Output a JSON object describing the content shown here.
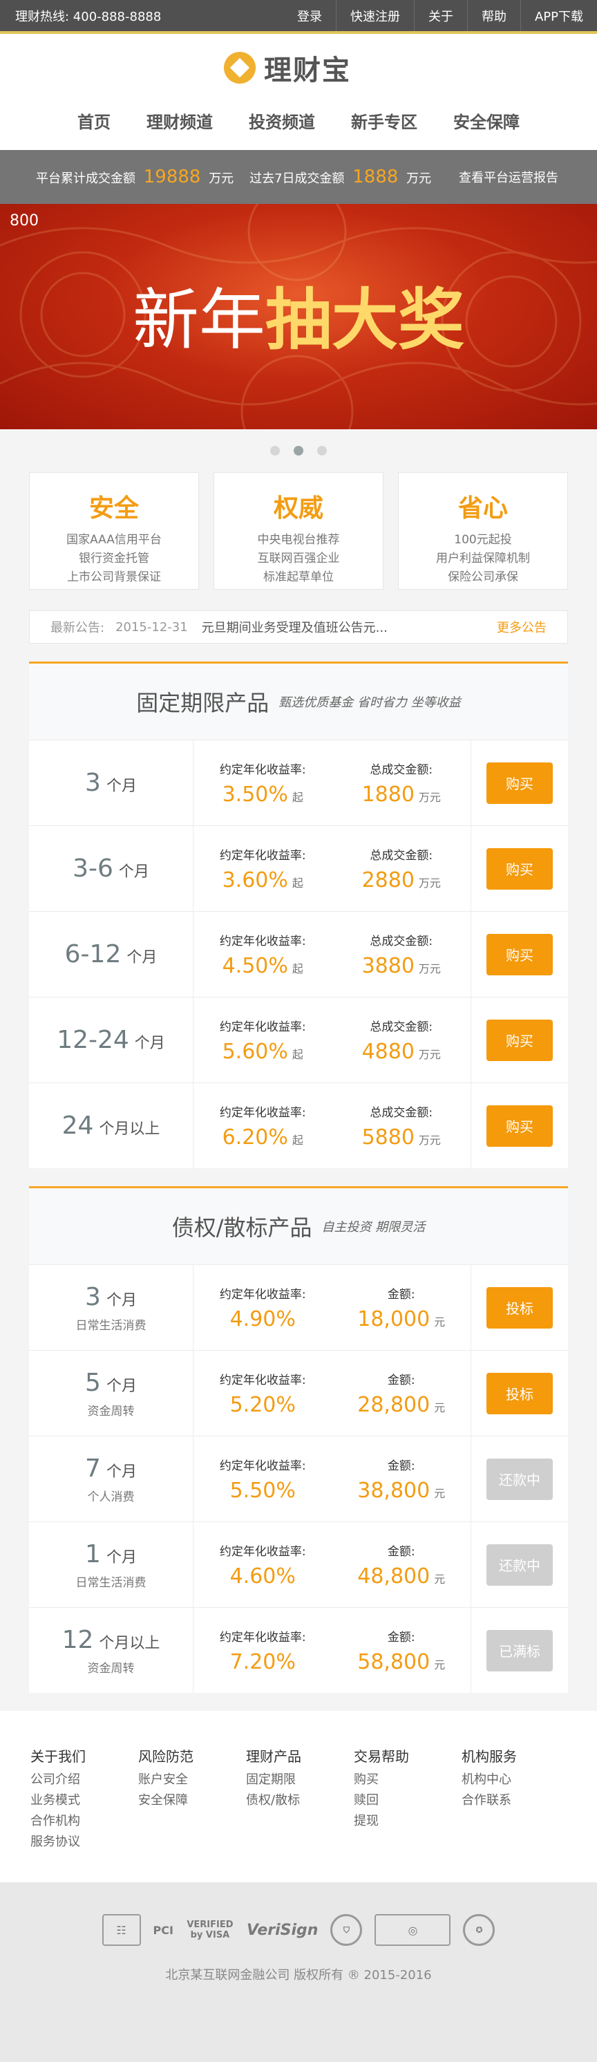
{
  "topbar": {
    "hotline": "理财热线: 400-888-8888",
    "links": [
      "登录",
      "快速注册",
      "关于",
      "帮助",
      "APP下载"
    ]
  },
  "header": {
    "logo_text": "理财宝",
    "nav": [
      "首页",
      "理财频道",
      "投资频道",
      "新手专区",
      "安全保障"
    ]
  },
  "stats": {
    "label1": "平台累计成交金额",
    "amount1": "19888",
    "unit1": "万元",
    "label2": "过去7日成交金额",
    "amount2": "1888",
    "unit2": "万元",
    "report": "查看平台运营报告"
  },
  "banner": {
    "size_label": "800",
    "title_normal": "新年",
    "title_highlight": "抽大奖",
    "slides": 3,
    "active_slide": 2
  },
  "features": [
    {
      "title": "安全",
      "lines": [
        "国家AAA信用平台",
        "银行资金托管",
        "上市公司背景保证"
      ]
    },
    {
      "title": "权威",
      "lines": [
        "中央电视台推荐",
        "互联网百强企业",
        "标准起草单位"
      ]
    },
    {
      "title": "省心",
      "lines": [
        "100元起投",
        "用户利益保障机制",
        "保险公司承保"
      ]
    }
  ],
  "notice": {
    "label": "最新公告:",
    "date": "2015-12-31",
    "content": "元旦期间业务受理及值班公告元...",
    "more": "更多公告"
  },
  "fixed": {
    "title": "固定期限产品",
    "subtitle": "甄选优质基金  省时省力  坐等收益",
    "rate_label": "约定年化收益率:",
    "amount_label": "总成交金额:",
    "rate_suffix": "起",
    "amount_unit": "万元",
    "rows": [
      {
        "term": "3",
        "unit": "个月",
        "rate": "3.50%",
        "amount": "1880",
        "button": "购买"
      },
      {
        "term": "3-6",
        "unit": "个月",
        "rate": "3.60%",
        "amount": "2880",
        "button": "购买"
      },
      {
        "term": "6-12",
        "unit": "个月",
        "rate": "4.50%",
        "amount": "3880",
        "button": "购买"
      },
      {
        "term": "12-24",
        "unit": "个月",
        "rate": "5.60%",
        "amount": "4880",
        "button": "购买"
      },
      {
        "term": "24",
        "unit": "个月以上",
        "rate": "6.20%",
        "amount": "5880",
        "button": "购买"
      }
    ]
  },
  "debt": {
    "title": "债权/散标产品",
    "subtitle": "自主投资  期限灵活",
    "rate_label": "约定年化收益率:",
    "amount_label": "金额:",
    "amount_unit": "元",
    "rows": [
      {
        "term": "3",
        "unit": "个月",
        "note": "日常生活消费",
        "rate": "4.90%",
        "amount": "18,000",
        "button": "投标",
        "enabled": true
      },
      {
        "term": "5",
        "unit": "个月",
        "note": "资金周转",
        "rate": "5.20%",
        "amount": "28,800",
        "button": "投标",
        "enabled": true
      },
      {
        "term": "7",
        "unit": "个月",
        "note": "个人消费",
        "rate": "5.50%",
        "amount": "38,800",
        "button": "还款中",
        "enabled": false
      },
      {
        "term": "1",
        "unit": "个月",
        "note": "日常生活消费",
        "rate": "4.60%",
        "amount": "48,800",
        "button": "还款中",
        "enabled": false
      },
      {
        "term": "12",
        "unit": "个月以上",
        "note": "资金周转",
        "rate": "7.20%",
        "amount": "58,800",
        "button": "已满标",
        "enabled": false
      }
    ]
  },
  "footer": {
    "columns": [
      {
        "title": "关于我们",
        "links": [
          "公司介绍",
          "业务模式",
          "合作机构",
          "服务协议"
        ]
      },
      {
        "title": "风险防范",
        "links": [
          "账户安全",
          "安全保障"
        ]
      },
      {
        "title": "理财产品",
        "links": [
          "固定期限",
          "债权/散标"
        ]
      },
      {
        "title": "交易帮助",
        "links": [
          "购买",
          "赎回",
          "提现"
        ]
      },
      {
        "title": "机构服务",
        "links": [
          "机构中心",
          "合作联系"
        ]
      }
    ],
    "certs": [
      "PCI",
      "VERIFIED by VISA",
      "VeriSign"
    ],
    "copyright": "北京某互联网金融公司 版权所有 ® 2015-2016"
  },
  "colors": {
    "accent": "#f59a0b",
    "topbar": "#505050",
    "stats_bar": "#757575",
    "banner_red": "#c22a10",
    "disabled": "#cfcfcf"
  }
}
